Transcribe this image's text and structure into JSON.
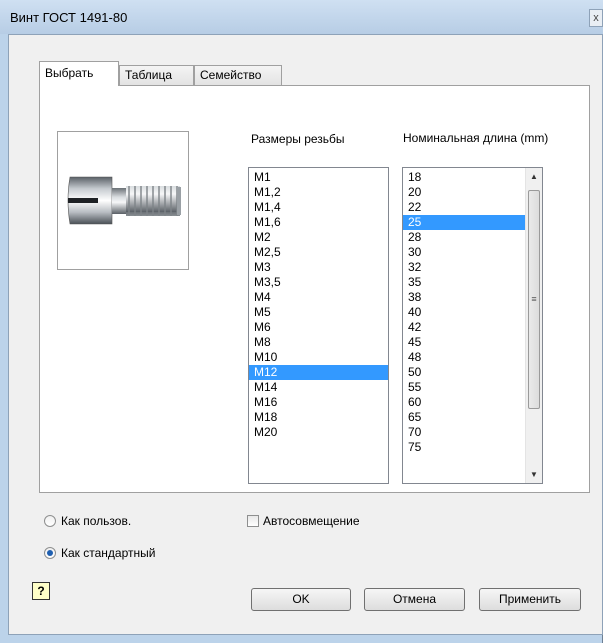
{
  "window": {
    "title": "Винт ГОСТ 1491-80",
    "close_glyph": "x"
  },
  "tabs": [
    {
      "label": "Выбрать",
      "active": true
    },
    {
      "label": "Таблица",
      "active": false
    },
    {
      "label": "Семейство",
      "active": false
    }
  ],
  "preview": {
    "icon": "screw-image"
  },
  "thread_sizes": {
    "header": "Размеры резьбы",
    "items": [
      "M1",
      "M1,2",
      "M1,4",
      "M1,6",
      "M2",
      "M2,5",
      "M3",
      "M3,5",
      "M4",
      "M5",
      "M6",
      "M8",
      "M10",
      "M12",
      "M14",
      "M16",
      "M18",
      "M20"
    ],
    "selected": "M12"
  },
  "nominal_length": {
    "header": "Номинальная длина (mm)",
    "items": [
      "18",
      "20",
      "22",
      "25",
      "28",
      "30",
      "32",
      "35",
      "38",
      "40",
      "42",
      "45",
      "48",
      "50",
      "55",
      "60",
      "65",
      "70",
      "75"
    ],
    "selected": "25"
  },
  "options": {
    "as_user_label": "Как пользов.",
    "as_user_checked": false,
    "as_standard_label": "Как стандартный",
    "as_standard_checked": true,
    "autoplace_label": "Автосовмещение",
    "autoplace_checked": false
  },
  "buttons": {
    "help_glyph": "?",
    "ok": "OK",
    "cancel": "Отмена",
    "apply": "Применить"
  }
}
